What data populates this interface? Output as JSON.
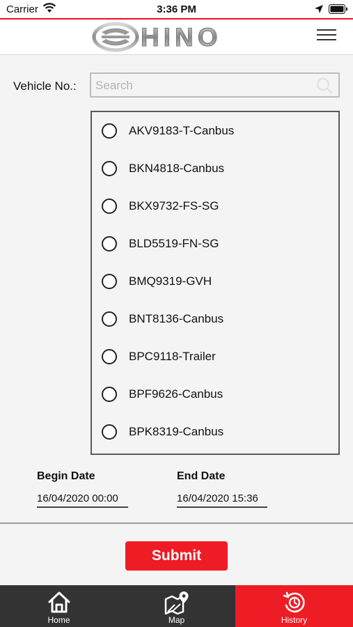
{
  "status_bar": {
    "carrier": "Carrier",
    "time": "3:36 PM"
  },
  "header": {
    "logo_text": "HINO",
    "brand_color": "#ee1c25"
  },
  "form": {
    "vehicle_label": "Vehicle No.:",
    "search_placeholder": "Search",
    "vehicles": [
      {
        "label": "AKV9183-T-Canbus",
        "selected": false
      },
      {
        "label": "BKN4818-Canbus",
        "selected": false
      },
      {
        "label": "BKX9732-FS-SG",
        "selected": false
      },
      {
        "label": "BLD5519-FN-SG",
        "selected": false
      },
      {
        "label": "BMQ9319-GVH",
        "selected": false
      },
      {
        "label": "BNT8136-Canbus",
        "selected": false
      },
      {
        "label": "BPC9118-Trailer",
        "selected": false
      },
      {
        "label": "BPF9626-Canbus",
        "selected": false
      },
      {
        "label": "BPK8319-Canbus",
        "selected": false
      }
    ],
    "begin_date_label": "Begin Date",
    "begin_date_value": "16/04/2020 00:00",
    "end_date_label": "End Date",
    "end_date_value": "16/04/2020 15:36",
    "submit_label": "Submit"
  },
  "bottom_nav": {
    "items": [
      {
        "label": "Home",
        "icon": "home-icon",
        "active": false
      },
      {
        "label": "Map",
        "icon": "map-icon",
        "active": false
      },
      {
        "label": "History",
        "icon": "history-icon",
        "active": true
      }
    ]
  }
}
